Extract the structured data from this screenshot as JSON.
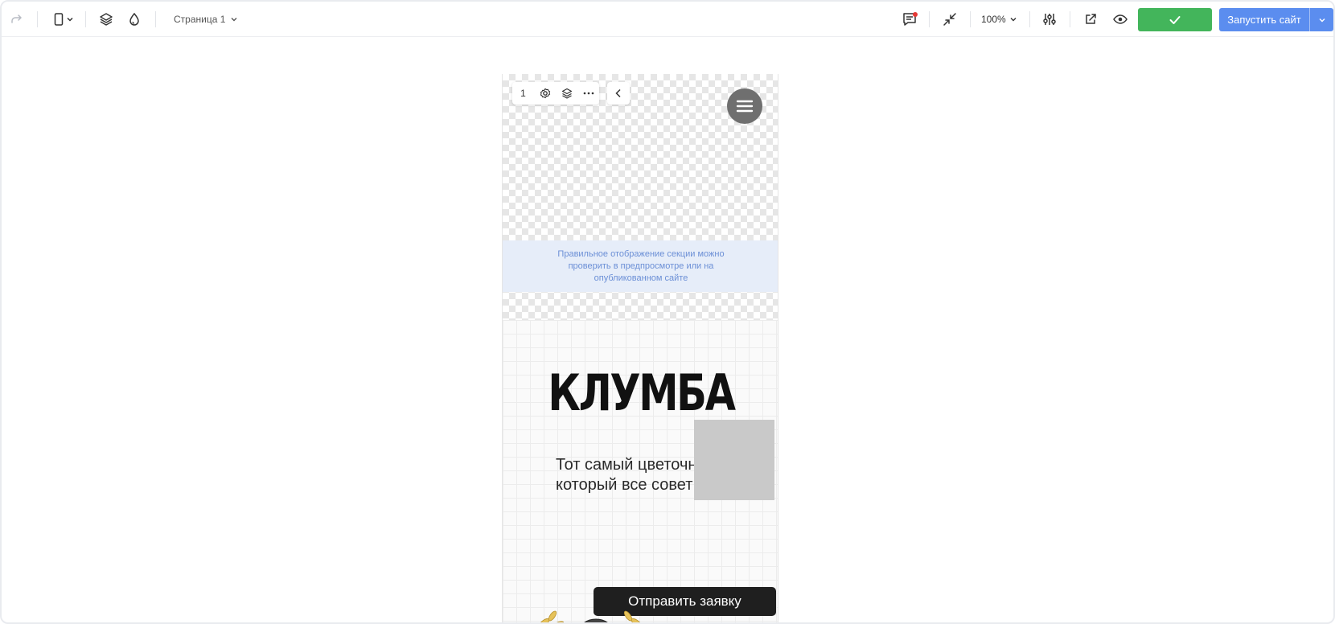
{
  "toolbar": {
    "page_label": "Страница 1",
    "zoom_label": "100%",
    "launch_label": "Запустить сайт",
    "icons": {
      "redo": "redo-icon",
      "device": "mobile-device-icon",
      "layers": "layers-icon",
      "drop": "color-drop-icon",
      "comments": "comments-icon",
      "collapse": "collapse-icon",
      "settings": "sliders-icon",
      "external": "external-link-icon",
      "preview": "eye-icon",
      "check": "check-icon"
    },
    "colors": {
      "publish_green": "#43b55b",
      "launch_blue": "#5b8def",
      "notification": "#e53935"
    }
  },
  "section_toolbar": {
    "number": "1"
  },
  "notice": {
    "text": "Правильное отображение секции можно проверить в предпросмотре или на опубликованном сайте"
  },
  "hero": {
    "title": "КЛУМБА",
    "subtitle": "Тот самый цветочн\nкоторый все совет",
    "cta_label": "Отправить заявку"
  }
}
